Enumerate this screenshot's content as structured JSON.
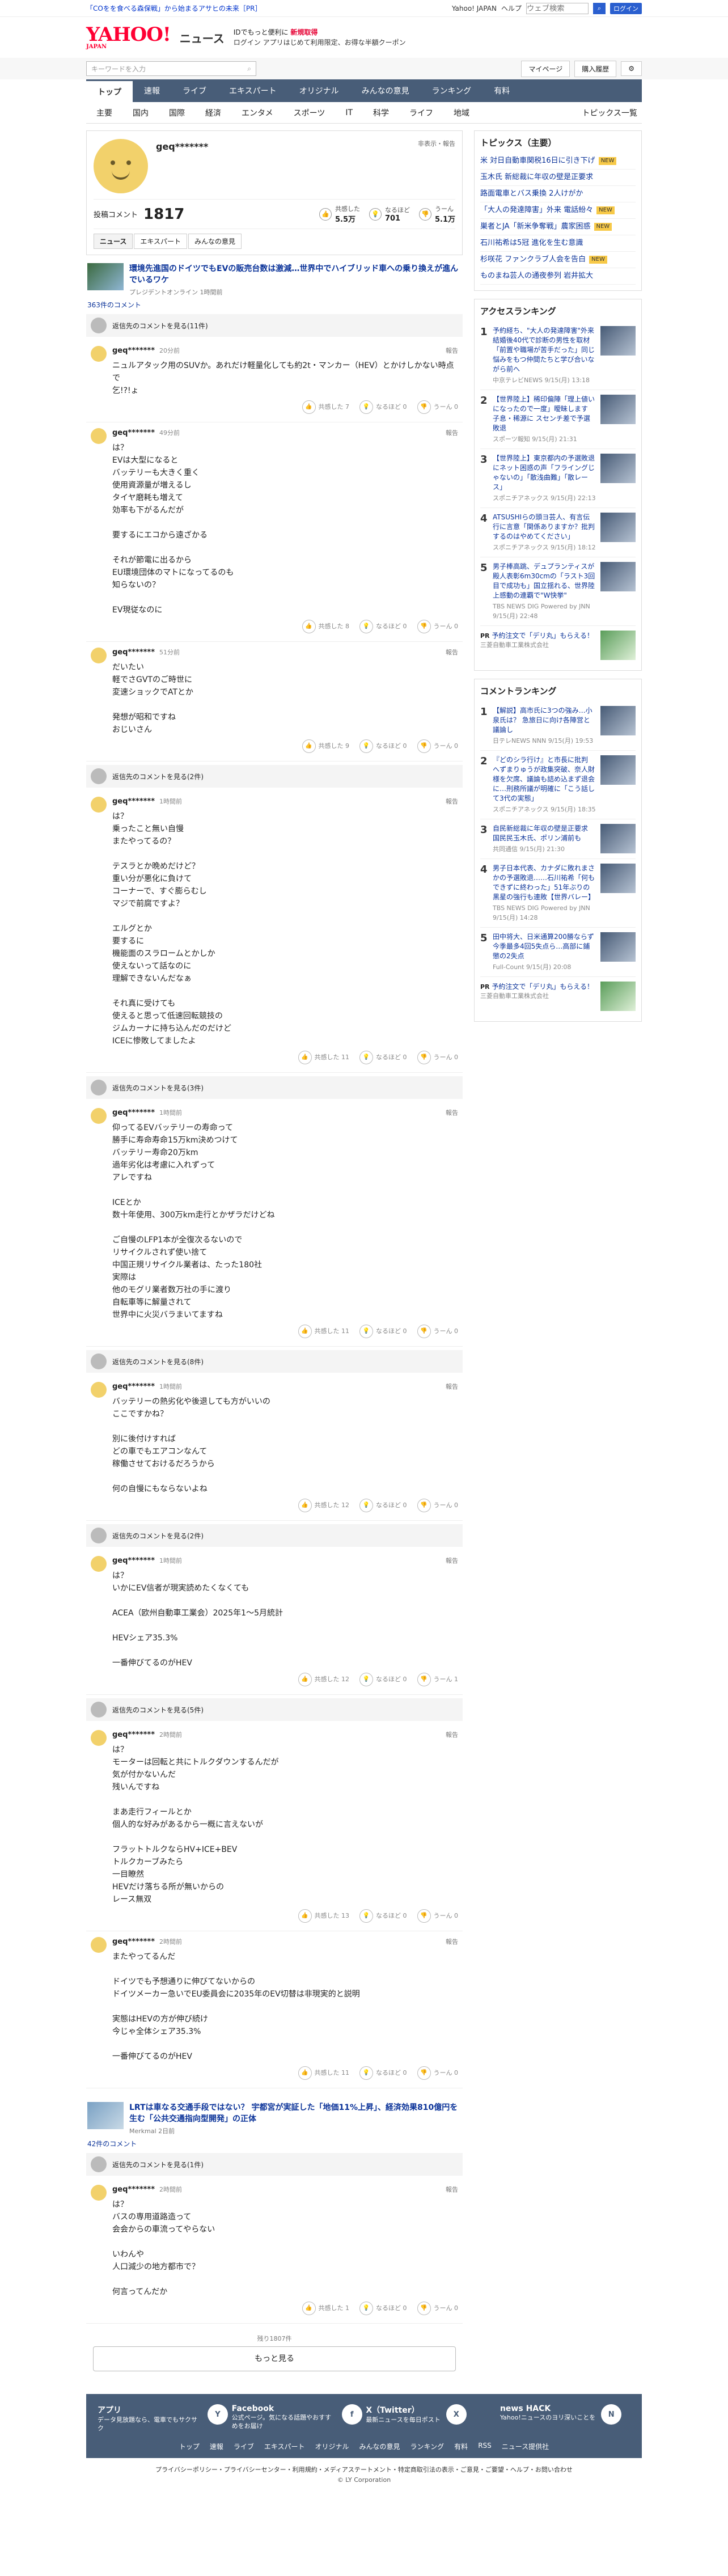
{
  "topbar": {
    "promo": "「COをを食べる森保戦」から始まるアサヒの未来［PR］",
    "links": [
      "Yahoo! JAPAN",
      "ヘルプ"
    ],
    "search_placeholder": "ウェブ検索",
    "search_btn": "検索",
    "login_btn": "ログイン"
  },
  "header": {
    "logo": "YAHOO!",
    "logo_sub": "JAPAN",
    "section": "ニュース",
    "msg1_prefix": "IDでもっと便利に",
    "msg1_link": "新規取得",
    "msg2": "ログイン アプリはじめて利用限定、お得な半額クーポン"
  },
  "search": {
    "placeholder": "キーワードを入力",
    "right": [
      "マイページ",
      "購入履歴"
    ]
  },
  "nav": [
    "トップ",
    "速報",
    "ライブ",
    "エキスパート",
    "オリジナル",
    "みんなの意見",
    "ランキング",
    "有料"
  ],
  "subnav": [
    "主要",
    "国内",
    "国際",
    "経済",
    "エンタメ",
    "スポーツ",
    "IT",
    "科学",
    "ライフ",
    "地域"
  ],
  "subnav_right": "トピックス一覧",
  "profile": {
    "name": "geq*******",
    "meta": "非表示・報告",
    "posts_label": "投稿コメント",
    "posts": "1817",
    "stats": [
      {
        "label": "共感した",
        "value": "5.5万"
      },
      {
        "label": "なるほど",
        "value": "701"
      },
      {
        "label": "うーん",
        "value": "5.1万"
      }
    ],
    "tabs": [
      "ニュース",
      "エキスパート",
      "みんなの意見"
    ]
  },
  "article1": {
    "title": "環境先進国のドイツでもEVの販売台数は激減…世界中でハイブリッド車への乗り換えが進んでいるワケ",
    "source": "プレジデントオンライン 1時間前",
    "count": "363件のコメント"
  },
  "reply_more": "返信先のコメントを見る(11件)",
  "comments": [
    {
      "user": "geq*******",
      "time": "20分前",
      "text": "ニュルアタック用のSUVか。あれだけ軽量化しても約2t・マンカー（HEV）とかけしかない時点で\n乞!?!ょ",
      "r": [
        "共感した 7",
        "なるほど 0",
        "うーん 0"
      ]
    },
    {
      "user": "geq*******",
      "time": "49分前",
      "text": "は？\nEVは大型になると\nバッテリーも大きく重く\n使用資源量が増えるし\nタイヤ磨耗も増えて\n効率も下がるんだが\n\n要するにエコから遠ざかる\n\nそれが節電に出るから\nEU環境団体のマトになってるのも\n知らないの？\n\nEV現従なのに",
      "r": [
        "共感した 8",
        "なるほど 0",
        "うーん 0"
      ]
    },
    {
      "user": "geq*******",
      "time": "51分前",
      "text": "だいたい\n軽でさGVTのご時世に\n変速ショックでATとか\n\n発想が昭和ですね\nおじいさん",
      "r": [
        "共感した 9",
        "なるほど 0",
        "うーん 0"
      ]
    },
    {
      "user": "geq*******",
      "time": "1時間前",
      "text": "は？\n乗ったこと無い自慢\nまたやってるの？\n\nテスラとか晩めだけど？\n重い分が悪化に負けて\nコーナーで、すぐ膨らむし\nマジで前腐ですよ？\n\nエルグとか\n要するに\n機能面のスラロームとかしか\n使えないって話なのに\n理解できないんだなぁ\n\nそれ真に受けても\n使えると思って低速回転競技の\nジムカーナに持ち込んだのだけど\nICEに惨敗してましたよ",
      "r": [
        "共感した 11",
        "なるほど 0",
        "うーん 0"
      ]
    },
    {
      "user": "geq*******",
      "time": "1時間前",
      "text": "仰ってるEVバッテリーの寿命って\n勝手に寿命寿命15万km決めつけて\nバッテリー寿命20万km\n過年劣化は考慮に入れずって\nアレですね\n\nICEとか\n数十年使用、300万km走行とかザラだけどね\n\nご自慢のLFP1本が全復次るないので\nリサイクルされず使い捨て\n中国正規リサイクル業者は、たった180社\n実際は\n他のモグリ業者数万社の手に渡り\n自転車等に解量されて\n世界中に火災バラまいてますね",
      "r": [
        "共感した 11",
        "なるほど 0",
        "うーん 0"
      ]
    },
    {
      "user": "geq*******",
      "time": "1時間前",
      "text": "バッテリーの熱劣化や後退しても方がいいの\nここですかね？\n\n別に後付けすれば\nどの車でもエアコンなんて\n稼働させておけるだろうから\n\n何の自慢にもならないよね",
      "r": [
        "共感した 12",
        "なるほど 0",
        "うーん 0"
      ]
    },
    {
      "user": "geq*******",
      "time": "1時間前",
      "text": "は？\nいかにEV信者が現実読めたくなくても\n\nACEA（欧州自動車工業会）2025年1〜5月統計\n\nHEVシェア35.3%\n\n一番伸びてるのがHEV",
      "r": [
        "共感した 12",
        "なるほど 0",
        "うーん 1"
      ]
    },
    {
      "user": "geq*******",
      "time": "2時間前",
      "text": "は？\nモーターは回転と共にトルクダウンするんだが\n気が付かないんだ\n残いんですね\n\nまあ走行フィールとか\n個人的な好みがあるから一概に言えないが\n\nフラットトルクならHV+ICE+BEV\nトルクカーブみたら\n一目瞭然\nHEVだけ落ちる所が無いからの\nレース無双",
      "r": [
        "共感した 13",
        "なるほど 0",
        "うーん 0"
      ]
    },
    {
      "user": "geq*******",
      "time": "2時間前",
      "text": "またやってるんだ\n\nドイツでも予想通りに伸びてないからの\nドイツメーカー急いでEU委員会に2035年のEV切替は非現実的と説明\n\n実態はHEVの方が伸び続け\n今じゃ全体シェア35.3%\n\n一番伸びてるのがHEV",
      "r": [
        "共感した 11",
        "なるほど 0",
        "うーん 0"
      ]
    }
  ],
  "reply_counts": [
    "返信先のコメントを見る(11件)",
    "返信先のコメントを見る(2件)",
    "返信先のコメントを見る(3件)",
    "返信先のコメントを見る(8件)",
    "返信先のコメントを見る(2件)",
    "返信先のコメントを見る(5件)"
  ],
  "article2": {
    "title": "LRTは車なる交通手段ではない？ 宇都宮が実証した「地価11%上昇」、経済効果810億円を生む「公共交通指向型開発」の正体",
    "source": "Merkmal 2日前",
    "count": "42件のコメント"
  },
  "reply_more2": "返信先のコメントを見る(1件)",
  "comment_last": {
    "user": "geq*******",
    "time": "2時間前",
    "text": "は？\nバスの専用道路造って\n会会からの車流ってやらない\n\nいわんや\n人口減少の地方都市で？\n\n何言ってんだか",
    "r": [
      "共感した 1",
      "なるほど 0",
      "うーん 0"
    ]
  },
  "more": {
    "count": "残り1807件",
    "button": "もっと見る"
  },
  "side_topics": {
    "title": "トピックス（主要）",
    "items": [
      {
        "t": "米 対日自動車関税16日に引き下げ",
        "n": "NEW"
      },
      {
        "t": "玉木氏 新総裁に年収の壁是正要求",
        "n": ""
      },
      {
        "t": "路面電車とバス乗換 2人けがか",
        "n": ""
      },
      {
        "t": "「大人の発達障害」外来 電話紛々",
        "n": "NEW"
      },
      {
        "t": "巣者とJA「新米争奪戦」農家困惑",
        "n": "NEW"
      },
      {
        "t": "石川祐希は5冠 進化を生む意識",
        "n": ""
      },
      {
        "t": "杉咲花 ファンクラブ人会を告白",
        "n": "NEW"
      },
      {
        "t": "ものまね芸人の通夜参列 岩井拡大",
        "n": ""
      }
    ]
  },
  "side_access": {
    "title": "アクセスランキング",
    "items": [
      {
        "t": "予約経ち、\"大人の発達障害\"外来 結婚後40代で診断の男性を取材「前置や職場が苦手だった」同じ悩みをもつ仲間たちと学び合いながら前へ",
        "s": "中京テレビNEWS 9/15(月) 13:18"
      },
      {
        "t": "【世界陸上】稀印偏陣「理上値いになったので一度」曖昧します 子息・稀源に スセンチ差で予選敗退",
        "s": "スポーツ報知 9/15(月) 21:31"
      },
      {
        "t": "【世界陸上】東京都内の予選敗退にネット困惑の声「フライングじゃないの」「散浅曲難」「散レース」",
        "s": "スポニチアネックス 9/15(月) 22:13"
      },
      {
        "t": "ATSUSHIらの頭ヨ芸人、有言伝行に言意「関係ありますか？批判するのはやめてください」",
        "s": "スポニチアネックス 9/15(月) 18:12"
      },
      {
        "t": "男子棒高跳、デュプランティスが殿人表彰6m30cmの「ラスト3回目で成功も」国立揺れる、世界陸上感動の連覇で\"W快挙\"",
        "s": "TBS NEWS DIG Powered by JNN 9/15(月) 22:48"
      }
    ]
  },
  "side_pr": {
    "label": "PR",
    "t": "予約注文で「デリ丸」もらえる！",
    "s": "三菱自動車工業株式会社"
  },
  "side_comment": {
    "title": "コメントランキング",
    "items": [
      {
        "t": "【解説】高市氏に3つの強み…小泉氏は？ 急旅日に向け各陣営と議論し",
        "s": "日テレNEWS NNN 9/15(月) 19:53"
      },
      {
        "t": "『どのシラ行け』と市長に批判 へずまりゅうが政集突破、奈人財様を欠席、議論も詰め込まず退会に…刑務所議が明確に「こう話して3代の実態」",
        "s": "スポニチアネックス 9/15(月) 18:35"
      },
      {
        "t": "自民新総裁に年収の壁是正要求 国民民玉木氏、ポリン浦前も",
        "s": "共同通信 9/15(月) 21:30"
      },
      {
        "t": "男子日本代表、カナダに敗れまさかの予選敗退……石川祐希「何もできずに終わった」51年ぶりの黒星の強行も連敗【世界バレー】",
        "s": "TBS NEWS DIG Powered by JNN 9/15(月) 14:28"
      },
      {
        "t": "田中将大、日米通算200勝ならず 今季最多4回5失点ら…高部に鋪懲の2失点",
        "s": "Full-Count 9/15(月) 20:08"
      }
    ]
  },
  "side_pr2": {
    "label": "PR",
    "t": "予約注文で「デリ丸」もらえる！",
    "s": "三菱自動車工業株式会社"
  },
  "footer": {
    "cols": [
      {
        "t": "アプリ",
        "d": "データ見放題なら、電車でもサクサク",
        "ic": "Y"
      },
      {
        "t": "Facebook",
        "d": "公式ページ。気になる話題やおすすめをお届け",
        "ic": "f"
      },
      {
        "t": "X（Twitter）",
        "d": "最新ニュースを毎日ポスト",
        "ic": "X"
      },
      {
        "t": "news HACK",
        "d": "Yahoo!ニュースのヨリ深いことを",
        "ic": "N"
      }
    ],
    "links": [
      "トップ",
      "速報",
      "ライブ",
      "エキスパート",
      "オリジナル",
      "みんなの意見",
      "ランキング",
      "有料",
      "RSS",
      "ニュース提供社"
    ],
    "legal": "プライバシーポリシー・プライバシーセンター・利用規約・メディアステートメント・特定商取引法の表示・ご意見・ご要望・ヘルプ・お問い合わせ",
    "copy": "© LY Corporation"
  }
}
